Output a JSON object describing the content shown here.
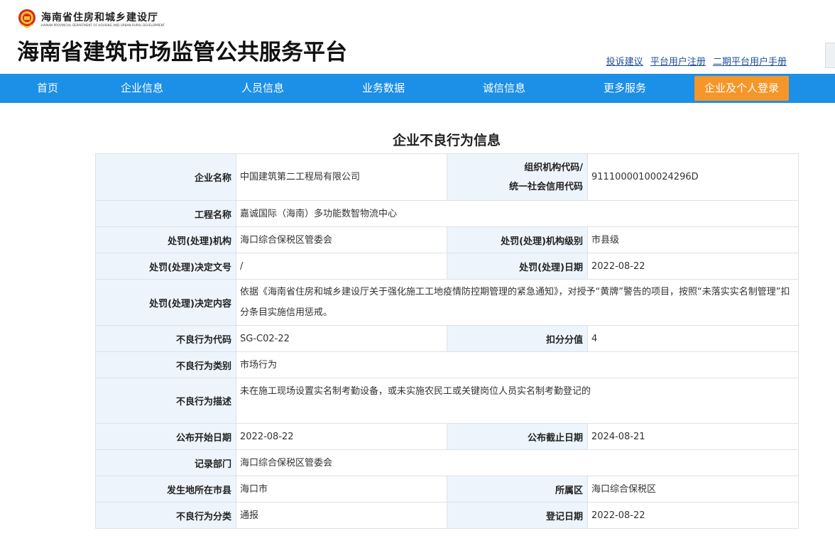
{
  "header": {
    "dept_name_cn": "海南省住房和城乡建设厅",
    "dept_name_en": "HAINAN PROVINCIAL DEPARTMENT OF HOUSING AND URBAN-RURAL DEVELOPMENT",
    "site_title": "海南省建筑市场监管公共服务平台",
    "links": [
      "投诉建议",
      "平台用户注册",
      "二期平台用户手册"
    ]
  },
  "nav": {
    "items": [
      "首页",
      "企业信息",
      "人员信息",
      "业务数据",
      "诚信信息",
      "更多服务"
    ],
    "login": "企业及个人登录"
  },
  "page_title": "企业不良行为信息",
  "record": {
    "company_label": "企业名称",
    "company": "中国建筑第二工程局有限公司",
    "org_code_label_1": "组织机构代码/",
    "org_code_label_2": "统一社会信用代码",
    "org_code": "91110000100024296D",
    "project_label": "工程名称",
    "project": "嘉诚国际（海南）多功能数智物流中心",
    "agency_label": "处罚(处理)机构",
    "agency": "海口综合保税区管委会",
    "agency_level_label": "处罚(处理)机构级别",
    "agency_level": "市县级",
    "doc_no_label": "处罚(处理)决定文号",
    "doc_no": "/",
    "decision_date_label": "处罚(处理)日期",
    "decision_date": "2022-08-22",
    "content_label": "处罚(处理)决定内容",
    "content": "依据《海南省住房和城乡建设厅关于强化施工工地疫情防控期管理的紧急通知》，对授予“黄牌”警告的项目，按照“未落实实名制管理”扣分条目实施信用惩戒。",
    "code_label": "不良行为代码",
    "code": "SG-C02-22",
    "points_label": "扣分分值",
    "points": "4",
    "category_label": "不良行为类别",
    "category": "市场行为",
    "desc_label": "不良行为描述",
    "desc": "未在施工现场设置实名制考勤设备，或未实施农民工或关键岗位人员实名制考勤登记的",
    "pub_start_label": "公布开始日期",
    "pub_start": "2022-08-22",
    "pub_end_label": "公布截止日期",
    "pub_end": "2024-08-21",
    "record_dept_label": "记录部门",
    "record_dept": "海口综合保税区管委会",
    "city_label": "发生地所在市县",
    "city": "海口市",
    "district_label": "所属区",
    "district": "海口综合保税区",
    "class_label": "不良行为分类",
    "class": "通报",
    "reg_date_label": "登记日期",
    "reg_date": "2022-08-22"
  },
  "colors": {
    "nav_bg": "#1c8fe6",
    "login_bg": "#f5962a",
    "label_bg": "#edf4fb",
    "link": "#1d4f9b"
  }
}
